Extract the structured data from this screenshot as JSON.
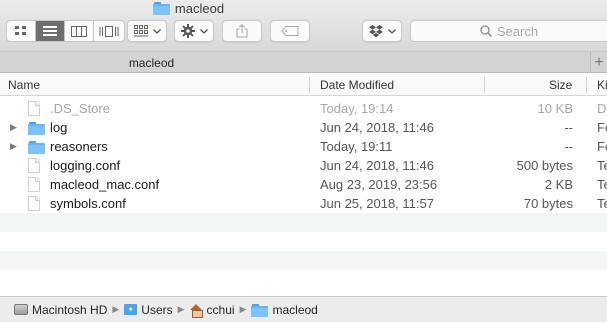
{
  "window": {
    "title": "macleod"
  },
  "toolbar": {
    "view_modes": [
      "icon-view",
      "list-view",
      "column-view",
      "cover-flow-view"
    ],
    "active_view": "list-view",
    "search_placeholder": "Search"
  },
  "tabs": [
    {
      "label": "macleod"
    }
  ],
  "columns": {
    "name": "Name",
    "date": "Date Modified",
    "size": "Size",
    "kind": "Ki"
  },
  "files": [
    {
      "name": ".DS_Store",
      "date": "Today, 19:14",
      "size": "10 KB",
      "kind": "D",
      "type": "file",
      "dim": true
    },
    {
      "name": "log",
      "date": "Jun 24, 2018, 11:46",
      "size": "--",
      "kind": "Fo",
      "type": "folder",
      "dim": false
    },
    {
      "name": "reasoners",
      "date": "Today, 19:11",
      "size": "--",
      "kind": "Fo",
      "type": "folder",
      "dim": false
    },
    {
      "name": "logging.conf",
      "date": "Jun 24, 2018, 11:46",
      "size": "500 bytes",
      "kind": "Te",
      "type": "file",
      "dim": false
    },
    {
      "name": "macleod_mac.conf",
      "date": "Aug 23, 2019, 23:56",
      "size": "2 KB",
      "kind": "Te",
      "type": "file",
      "dim": false
    },
    {
      "name": "symbols.conf",
      "date": "Jun 25, 2018, 11:57",
      "size": "70 bytes",
      "kind": "Te",
      "type": "file",
      "dim": false
    }
  ],
  "path": [
    "Macintosh HD",
    "Users",
    "cchui",
    "macleod"
  ],
  "colors": {
    "folder": "#64b5f6",
    "active_segment": "#6e6e6e"
  }
}
